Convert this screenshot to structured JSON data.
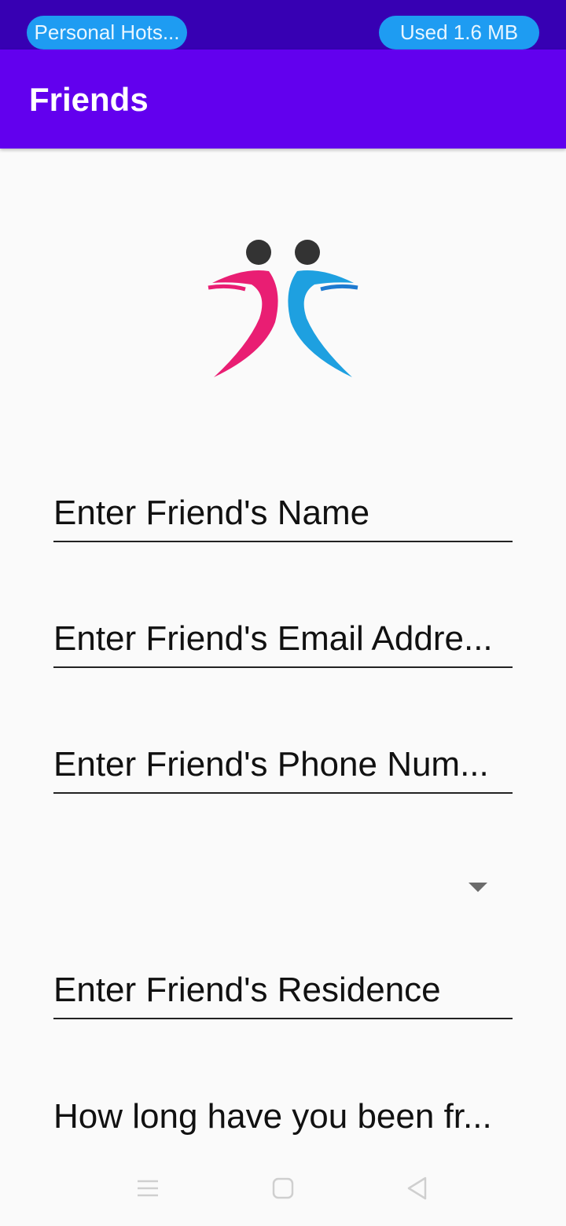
{
  "status_bar": {
    "hotspot_label": "Personal Hots...",
    "data_usage": "Used  1.6 MB"
  },
  "app_bar": {
    "title": "Friends"
  },
  "logo": {
    "icon": "friends-logo-icon",
    "colors": {
      "left": "#e91e73",
      "right": "#1ea0e0",
      "heads": "#333333"
    }
  },
  "form": {
    "name_placeholder": "Enter Friend's Name",
    "email_placeholder": "Enter Friend's Email Addre...",
    "phone_placeholder": "Enter Friend's Phone Num...",
    "spinner_value": "",
    "residence_placeholder": "Enter Friend's Residence",
    "duration_placeholder": "How long have you been fr..."
  },
  "nav_bar": {
    "icons": [
      "menu-icon",
      "home-icon",
      "back-icon"
    ]
  },
  "colors": {
    "status_bar": "#3700b3",
    "app_bar": "#6200ee",
    "pill": "#1e9cf2",
    "background": "#fafafa"
  }
}
